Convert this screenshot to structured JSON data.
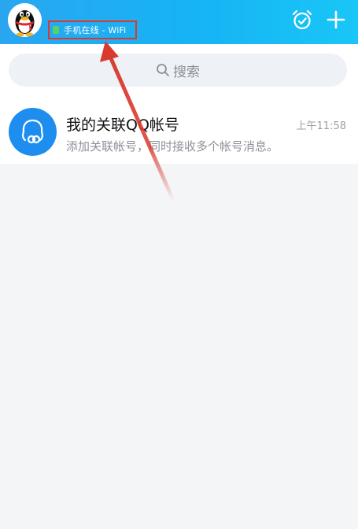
{
  "header": {
    "status_text": "手机在线 - WiFi",
    "status_color": "#55d26c",
    "gradient_start": "#2aa6f0",
    "gradient_end": "#19c6f7",
    "right_icons": [
      "alarm-clock-icon",
      "plus-icon"
    ]
  },
  "search": {
    "placeholder": "搜索"
  },
  "conversation": {
    "title": "我的关联QQ帐号",
    "time": "上午11:58",
    "subtitle": "添加关联帐号，同时接收多个帐号消息。",
    "avatar_icon": "linked-account-icon",
    "avatar_color": "#1d8ef0"
  },
  "annotation": {
    "highlight_color": "#d93a30",
    "arrow_color": "#d93a30"
  }
}
